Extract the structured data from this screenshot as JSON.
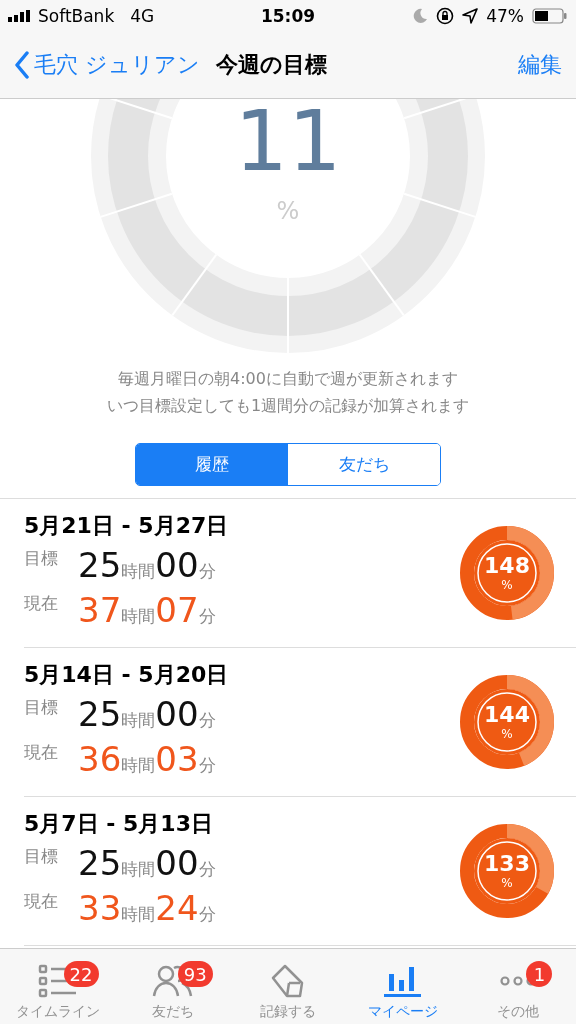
{
  "status_bar": {
    "carrier": "SoftBank",
    "network": "4G",
    "time": "15:09",
    "battery": "47%"
  },
  "nav": {
    "back": "毛穴 ジュリアン",
    "title": "今週の目標",
    "action": "編集"
  },
  "progress": {
    "value": "11",
    "unit": "%"
  },
  "notes": [
    "毎週月曜日の朝4:00に自動で週が更新されます",
    "いつ目標設定しても1週間分の記録が加算されます"
  ],
  "segments": [
    {
      "label": "履歴",
      "selected": true
    },
    {
      "label": "友だち",
      "selected": false
    }
  ],
  "weeks": [
    {
      "range": "5月21日 - 5月27日",
      "goal": {
        "label": "目標",
        "hours": "25",
        "hour_unit": "時間",
        "minutes": "00",
        "min_unit": "分"
      },
      "current": {
        "label": "現在",
        "hours": "37",
        "hour_unit": "時間",
        "minutes": "07",
        "min_unit": "分"
      },
      "percent": "148",
      "percent_unit": "%",
      "level": 0.48
    },
    {
      "range": "5月14日 - 5月20日",
      "goal": {
        "label": "目標",
        "hours": "25",
        "hour_unit": "時間",
        "minutes": "00",
        "min_unit": "分"
      },
      "current": {
        "label": "現在",
        "hours": "36",
        "hour_unit": "時間",
        "minutes": "03",
        "min_unit": "分"
      },
      "percent": "144",
      "percent_unit": "%",
      "level": 0.44
    },
    {
      "range": "5月7日 - 5月13日",
      "goal": {
        "label": "目標",
        "hours": "25",
        "hour_unit": "時間",
        "minutes": "00",
        "min_unit": "分"
      },
      "current": {
        "label": "現在",
        "hours": "33",
        "hour_unit": "時間",
        "minutes": "24",
        "min_unit": "分"
      },
      "percent": "133",
      "percent_unit": "%",
      "level": 0.33
    }
  ],
  "tabs": [
    {
      "kind": "list",
      "label": "タイムライン",
      "badge": "22",
      "selected": false
    },
    {
      "kind": "people",
      "label": "友だち",
      "badge": "93",
      "selected": false
    },
    {
      "kind": "eraser",
      "label": "記録する",
      "selected": false
    },
    {
      "kind": "chart",
      "label": "マイページ",
      "selected": true
    },
    {
      "kind": "more",
      "label": "その他",
      "badge": "1",
      "selected": false
    }
  ]
}
